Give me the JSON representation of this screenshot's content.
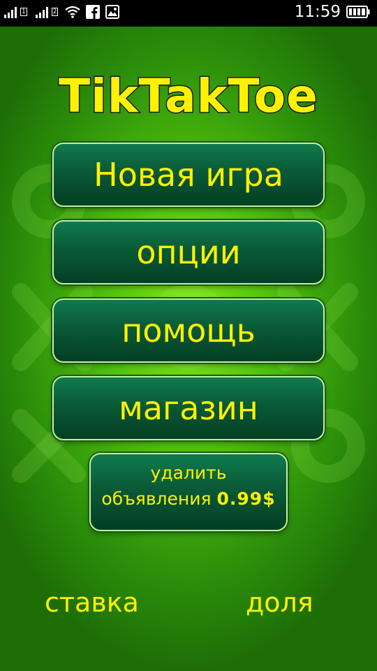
{
  "status_bar": {
    "time": "11:59",
    "icons": [
      "signal-icon",
      "signal-icon",
      "wifi-icon",
      "facebook-icon",
      "image-icon",
      "battery-icon"
    ]
  },
  "app": {
    "logo_text": "TikTakToe",
    "colors": {
      "button_text": "#fff200",
      "button_bg": "#0a5a37",
      "background": "#52c40e"
    }
  },
  "menu": {
    "new_game": "Новая игра",
    "options": "опции",
    "help": "помощь",
    "shop": "магазин",
    "remove_ads_line1": "удалить",
    "remove_ads_line2": "объявления",
    "remove_ads_price": "0.99$"
  },
  "footer": {
    "bet": "ставка",
    "share": "доля"
  }
}
